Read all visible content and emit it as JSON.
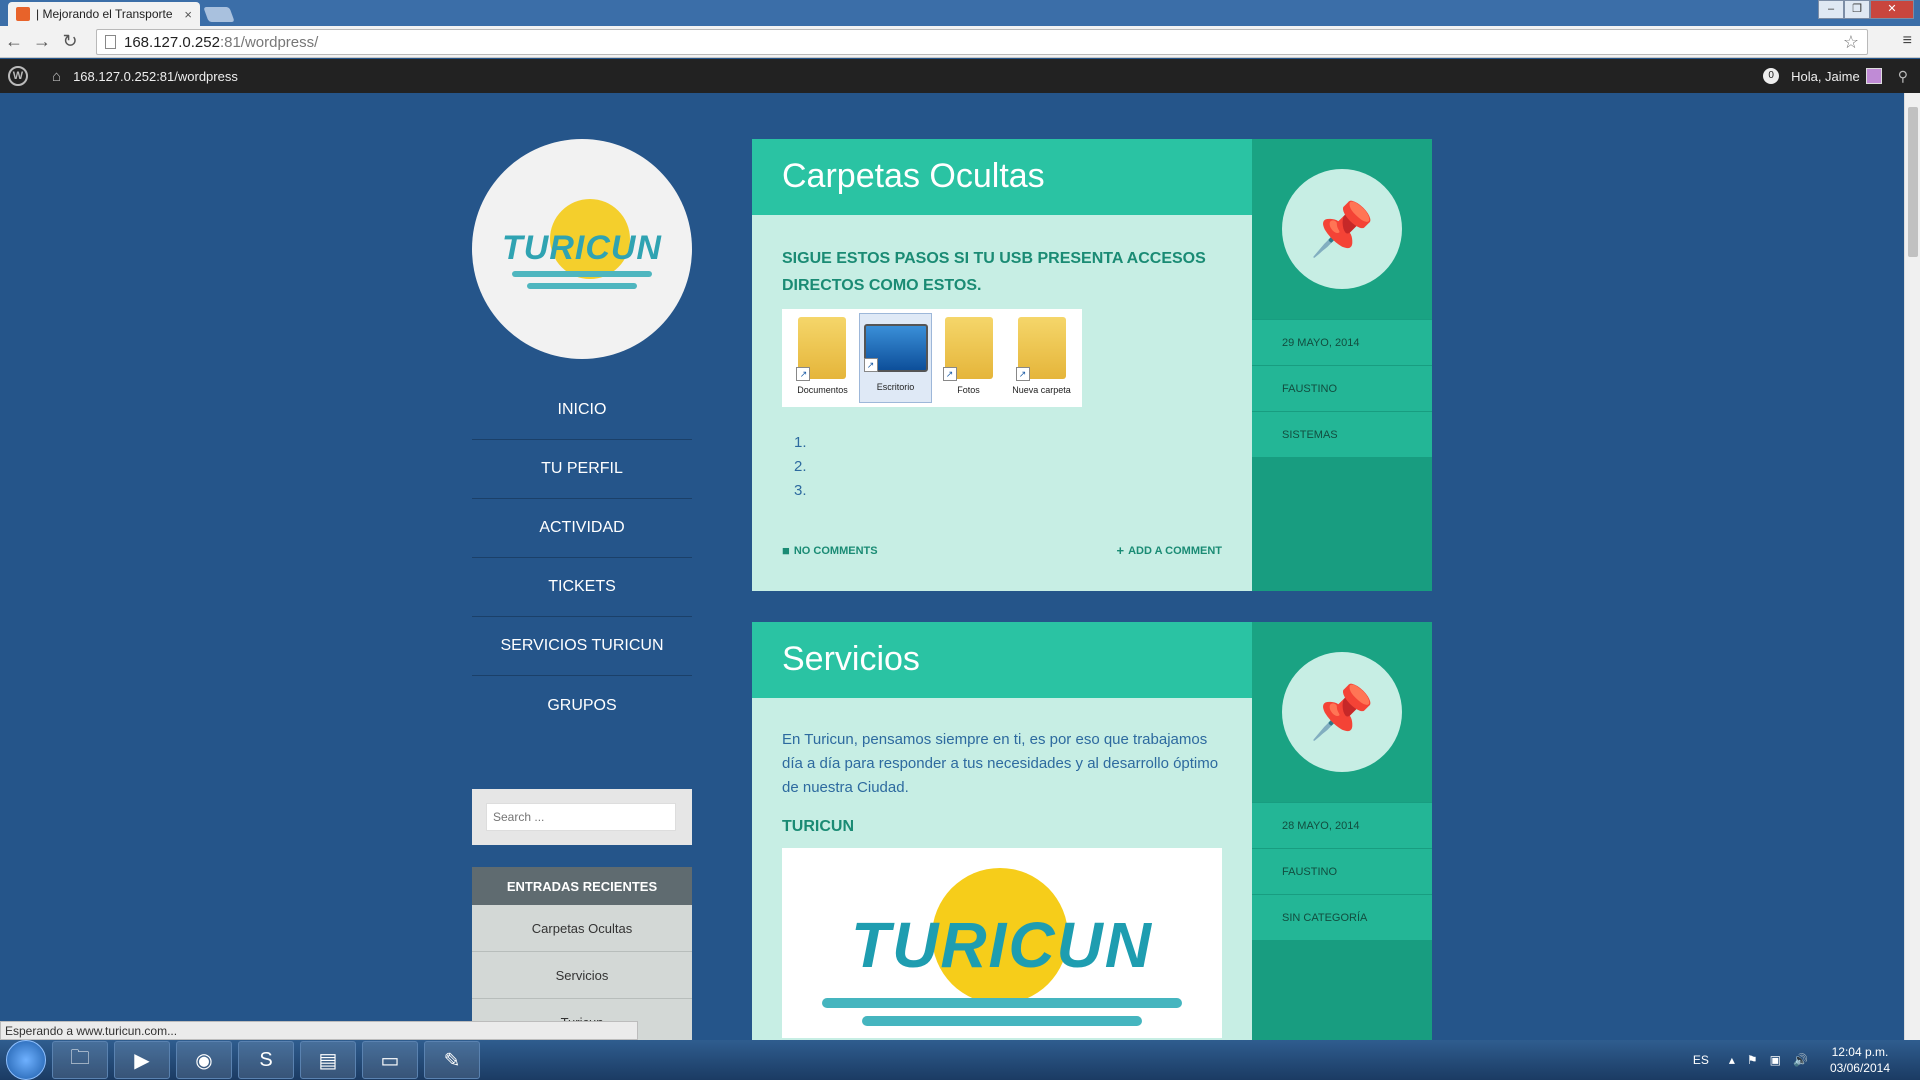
{
  "browser": {
    "tab_title": "| Mejorando el Transporte",
    "tab_close": "×",
    "url_host": "168.127.0.252",
    "url_path": ":81/wordpress/",
    "window_buttons": [
      "–",
      "❐",
      "✕"
    ]
  },
  "adminbar": {
    "site": "168.127.0.252:81/wordpress",
    "comment_count": "0",
    "greeting": "Hola, Jaime"
  },
  "sidebar": {
    "logo_text": "TURICUN",
    "nav": [
      "INICIO",
      "TU PERFIL",
      "ACTIVIDAD",
      "TICKETS",
      "SERVICIOS TURICUN",
      "GRUPOS"
    ],
    "search_placeholder": "Search ...",
    "recent_heading": "ENTRADAS RECIENTES",
    "recent_items": [
      "Carpetas Ocultas",
      "Servicios",
      "Turicun"
    ]
  },
  "posts": [
    {
      "title": "Carpetas Ocultas",
      "intro": "SIGUE ESTOS PASOS SI TU USB PRESENTA ACCESOS DIRECTOS COMO ESTOS.",
      "folders": [
        "Documentos",
        "Escritorio",
        "Fotos",
        "Nueva carpeta"
      ],
      "list": [
        "1.",
        "2.",
        "3."
      ],
      "comments": "NO COMMENTS",
      "add_comment": "ADD A COMMENT",
      "date": "29 MAYO, 2014",
      "author": "FAUSTINO",
      "category": "SISTEMAS"
    },
    {
      "title": "Servicios",
      "text": "En Turicun, pensamos siempre en ti, es por eso que trabajamos día a día para responder a tus necesidades y al desarrollo óptimo de nuestra Ciudad.",
      "subheading": "TURICUN",
      "logo_text": "TURICUN",
      "date": "28 MAYO, 2014",
      "author": "FAUSTINO",
      "category": "SIN CATEGORÍA"
    }
  ],
  "status": "Esperando a www.turicun.com...",
  "taskbar": {
    "lang": "ES",
    "time": "12:04 p.m.",
    "date": "03/06/2014"
  },
  "colors": {
    "background": "#25558a",
    "post_header": "#2ac3a3",
    "post_body": "#c7eee4",
    "meta_panel": "#189d80"
  }
}
